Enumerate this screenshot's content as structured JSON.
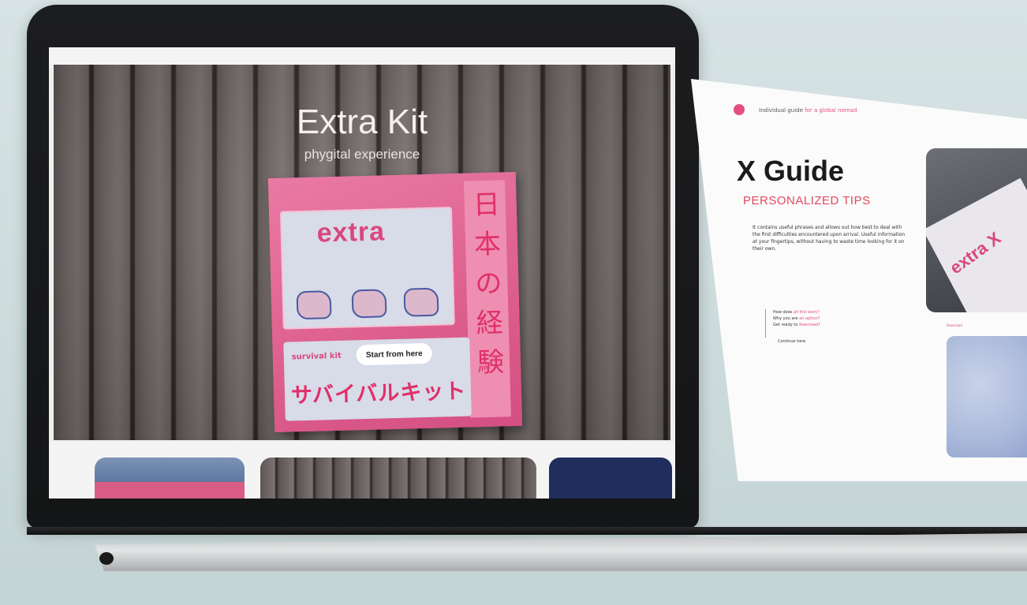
{
  "laptop_page": {
    "hero_title": "Extra Kit",
    "hero_subtitle": "phygital experience",
    "booklet": {
      "logo": "extra",
      "caption": "",
      "red_line": "",
      "vertical_jp": [
        "日",
        "本",
        "の",
        "経",
        "験"
      ],
      "survival_label": "survival kit",
      "start_button": "Start from here",
      "katakana": "サバイバルキット"
    }
  },
  "floating_page": {
    "tagline_prefix": "Individual guide",
    "tagline_pink": "for a global nomad",
    "title": "X Guide",
    "subtitle": "PERSONALIZED TIPS",
    "body": "It contains useful phrases and allows out how best to deal with the first difficulties encountered upon arrival. Useful information at your fingertips, without having to waste time looking for it on their own.",
    "list_items": [
      {
        "prefix": "How does ",
        "highlight": "all this work?",
        "suffix": ""
      },
      {
        "prefix": "Why you are ",
        "highlight": "an option?",
        "suffix": ""
      },
      {
        "prefix": "Get ready to ",
        "highlight": "download?",
        "suffix": ""
      }
    ],
    "continue_label": "Continue here",
    "card_text": "extra X",
    "small_label": "Download"
  }
}
